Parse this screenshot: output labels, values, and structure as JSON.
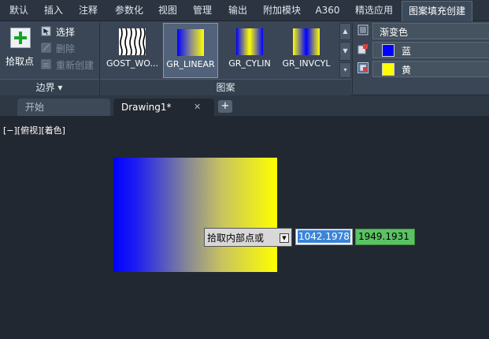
{
  "ribbon_tabs": [
    "默认",
    "插入",
    "注释",
    "参数化",
    "视图",
    "管理",
    "输出",
    "附加模块",
    "A360",
    "精选应用",
    "图案填充创建"
  ],
  "active_tab_index": 10,
  "boundary_panel": {
    "pick_label": "拾取点",
    "select_label": "选择",
    "remove_label": "删除",
    "recreate_label": "重新创建",
    "title": "边界 ▾"
  },
  "pattern_panel": {
    "title": "图案",
    "patterns": [
      {
        "label": "GOST_WO...",
        "selected": false,
        "icon": "hatch-pattern-swatch"
      },
      {
        "label": "GR_LINEAR",
        "selected": true,
        "icon": "linear-gradient-swatch"
      },
      {
        "label": "GR_CYLIN",
        "selected": false,
        "icon": "cylinder-gradient-swatch"
      },
      {
        "label": "GR_INVCYL",
        "selected": false,
        "icon": "inverse-cylinder-gradient-swatch"
      }
    ]
  },
  "properties_panel": {
    "hatch_type": "渐变色",
    "color1_name": "蓝",
    "color1_hex": "#0000ff",
    "color2_name": "黄",
    "color2_hex": "#ffff00"
  },
  "file_tabs": {
    "start_label": "开始",
    "drawing_label": "Drawing1*",
    "close_glyph": "✕",
    "new_glyph": "+"
  },
  "viewport": {
    "view_control": "[−][俯视][着色]"
  },
  "command_input": {
    "prompt": "拾取内部点或",
    "dropdown_glyph": "▼",
    "x_value": "1042.1978",
    "y_value": "1949.1931"
  }
}
